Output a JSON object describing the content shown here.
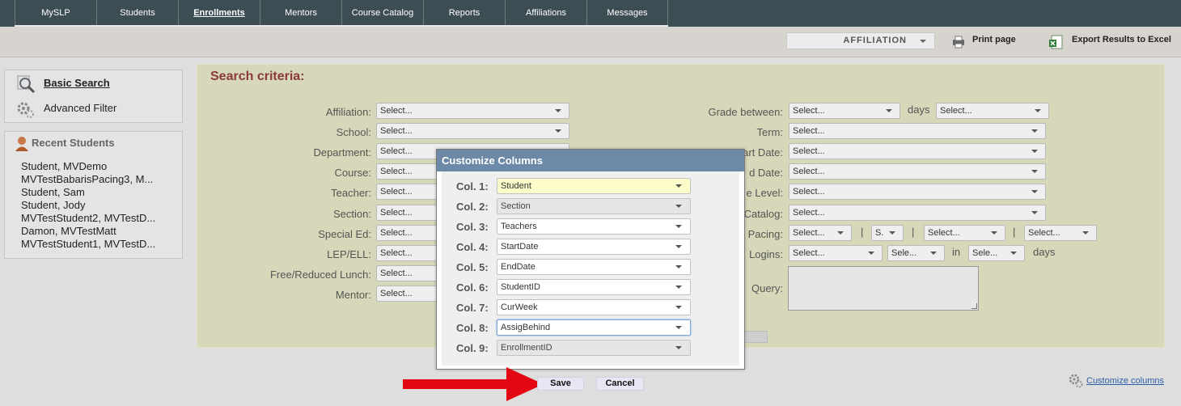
{
  "nav": {
    "tabs": [
      "MySLP",
      "Students",
      "Enrollments",
      "Mentors",
      "Course Catalog",
      "Reports",
      "Affiliations",
      "Messages"
    ],
    "active": "Enrollments"
  },
  "toolbar": {
    "affiliation": "AFFILIATION",
    "print": "Print page",
    "export": "Export Results to Excel"
  },
  "sidebar": {
    "basic_search": "Basic Search",
    "advanced_filter": "Advanced Filter",
    "recent_title": "Recent Students",
    "recent": [
      "Student, MVDemo",
      "MVTestBabarisPacing3, M...",
      "Student, Sam",
      "Student, Jody",
      "MVTestStudent2, MVTestD...",
      "Damon, MVTestMatt",
      "MVTestStudent1, MVTestD..."
    ]
  },
  "criteria": {
    "title": "Search criteria:",
    "select_placeholder": "Select...",
    "select_short1": "S.",
    "select_short2": "Sele...",
    "left_labels": [
      "Affiliation:",
      "School:",
      "Department:",
      "Course:",
      "Teacher:",
      "Section:",
      "Special Ed:",
      "LEP/ELL:",
      "Free/Reduced Lunch:",
      "Mentor:"
    ],
    "right_labels": [
      "Grade between:",
      "Term:",
      "Start Date:",
      "d Date:",
      "e Level:",
      "Catalog:",
      "Pacing:",
      "Logins:",
      "Query:"
    ],
    "days": "days",
    "pipe": "|",
    "in": "in"
  },
  "modal": {
    "title": "Customize Columns",
    "columns": [
      {
        "label": "Col. 1:",
        "value": "Student"
      },
      {
        "label": "Col. 2:",
        "value": "Section"
      },
      {
        "label": "Col. 3:",
        "value": "Teachers"
      },
      {
        "label": "Col. 4:",
        "value": "StartDate"
      },
      {
        "label": "Col. 5:",
        "value": "EndDate"
      },
      {
        "label": "Col. 6:",
        "value": "StudentID"
      },
      {
        "label": "Col. 7:",
        "value": "CurWeek"
      },
      {
        "label": "Col. 8:",
        "value": "AssigBehind"
      },
      {
        "label": "Col. 9:",
        "value": "EnrollmentID"
      }
    ]
  },
  "buttons": {
    "save": "Save",
    "cancel": "Cancel",
    "customize": "Customize columns"
  },
  "colors": {
    "nav": "#3c4e54",
    "criteria_bg": "#d7d7b9",
    "title_red": "#8b3a3a",
    "modal_header": "#6d89a8",
    "arrow_red": "#e30613",
    "link_blue": "#2b5da8"
  }
}
